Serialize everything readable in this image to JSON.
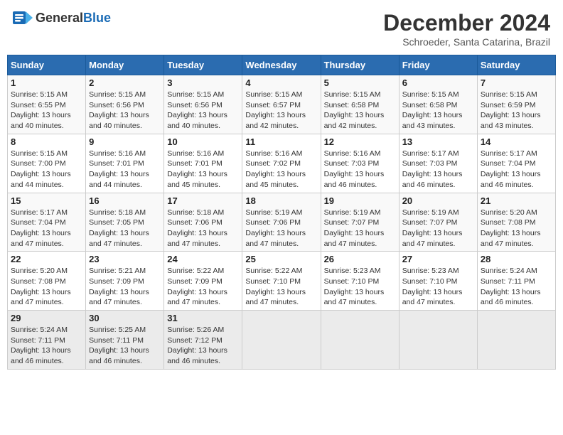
{
  "header": {
    "logo_general": "General",
    "logo_blue": "Blue",
    "month_title": "December 2024",
    "location": "Schroeder, Santa Catarina, Brazil"
  },
  "weekdays": [
    "Sunday",
    "Monday",
    "Tuesday",
    "Wednesday",
    "Thursday",
    "Friday",
    "Saturday"
  ],
  "weeks": [
    [
      {
        "day": "1",
        "sunrise": "5:15 AM",
        "sunset": "6:55 PM",
        "daylight": "13 hours and 40 minutes."
      },
      {
        "day": "2",
        "sunrise": "5:15 AM",
        "sunset": "6:56 PM",
        "daylight": "13 hours and 40 minutes."
      },
      {
        "day": "3",
        "sunrise": "5:15 AM",
        "sunset": "6:56 PM",
        "daylight": "13 hours and 40 minutes."
      },
      {
        "day": "4",
        "sunrise": "5:15 AM",
        "sunset": "6:57 PM",
        "daylight": "13 hours and 42 minutes."
      },
      {
        "day": "5",
        "sunrise": "5:15 AM",
        "sunset": "6:58 PM",
        "daylight": "13 hours and 42 minutes."
      },
      {
        "day": "6",
        "sunrise": "5:15 AM",
        "sunset": "6:58 PM",
        "daylight": "13 hours and 43 minutes."
      },
      {
        "day": "7",
        "sunrise": "5:15 AM",
        "sunset": "6:59 PM",
        "daylight": "13 hours and 43 minutes."
      }
    ],
    [
      {
        "day": "8",
        "sunrise": "5:15 AM",
        "sunset": "7:00 PM",
        "daylight": "13 hours and 44 minutes."
      },
      {
        "day": "9",
        "sunrise": "5:16 AM",
        "sunset": "7:01 PM",
        "daylight": "13 hours and 44 minutes."
      },
      {
        "day": "10",
        "sunrise": "5:16 AM",
        "sunset": "7:01 PM",
        "daylight": "13 hours and 45 minutes."
      },
      {
        "day": "11",
        "sunrise": "5:16 AM",
        "sunset": "7:02 PM",
        "daylight": "13 hours and 45 minutes."
      },
      {
        "day": "12",
        "sunrise": "5:16 AM",
        "sunset": "7:03 PM",
        "daylight": "13 hours and 46 minutes."
      },
      {
        "day": "13",
        "sunrise": "5:17 AM",
        "sunset": "7:03 PM",
        "daylight": "13 hours and 46 minutes."
      },
      {
        "day": "14",
        "sunrise": "5:17 AM",
        "sunset": "7:04 PM",
        "daylight": "13 hours and 46 minutes."
      }
    ],
    [
      {
        "day": "15",
        "sunrise": "5:17 AM",
        "sunset": "7:04 PM",
        "daylight": "13 hours and 47 minutes."
      },
      {
        "day": "16",
        "sunrise": "5:18 AM",
        "sunset": "7:05 PM",
        "daylight": "13 hours and 47 minutes."
      },
      {
        "day": "17",
        "sunrise": "5:18 AM",
        "sunset": "7:06 PM",
        "daylight": "13 hours and 47 minutes."
      },
      {
        "day": "18",
        "sunrise": "5:19 AM",
        "sunset": "7:06 PM",
        "daylight": "13 hours and 47 minutes."
      },
      {
        "day": "19",
        "sunrise": "5:19 AM",
        "sunset": "7:07 PM",
        "daylight": "13 hours and 47 minutes."
      },
      {
        "day": "20",
        "sunrise": "5:19 AM",
        "sunset": "7:07 PM",
        "daylight": "13 hours and 47 minutes."
      },
      {
        "day": "21",
        "sunrise": "5:20 AM",
        "sunset": "7:08 PM",
        "daylight": "13 hours and 47 minutes."
      }
    ],
    [
      {
        "day": "22",
        "sunrise": "5:20 AM",
        "sunset": "7:08 PM",
        "daylight": "13 hours and 47 minutes."
      },
      {
        "day": "23",
        "sunrise": "5:21 AM",
        "sunset": "7:09 PM",
        "daylight": "13 hours and 47 minutes."
      },
      {
        "day": "24",
        "sunrise": "5:22 AM",
        "sunset": "7:09 PM",
        "daylight": "13 hours and 47 minutes."
      },
      {
        "day": "25",
        "sunrise": "5:22 AM",
        "sunset": "7:10 PM",
        "daylight": "13 hours and 47 minutes."
      },
      {
        "day": "26",
        "sunrise": "5:23 AM",
        "sunset": "7:10 PM",
        "daylight": "13 hours and 47 minutes."
      },
      {
        "day": "27",
        "sunrise": "5:23 AM",
        "sunset": "7:10 PM",
        "daylight": "13 hours and 47 minutes."
      },
      {
        "day": "28",
        "sunrise": "5:24 AM",
        "sunset": "7:11 PM",
        "daylight": "13 hours and 46 minutes."
      }
    ],
    [
      {
        "day": "29",
        "sunrise": "5:24 AM",
        "sunset": "7:11 PM",
        "daylight": "13 hours and 46 minutes."
      },
      {
        "day": "30",
        "sunrise": "5:25 AM",
        "sunset": "7:11 PM",
        "daylight": "13 hours and 46 minutes."
      },
      {
        "day": "31",
        "sunrise": "5:26 AM",
        "sunset": "7:12 PM",
        "daylight": "13 hours and 46 minutes."
      },
      null,
      null,
      null,
      null
    ]
  ]
}
